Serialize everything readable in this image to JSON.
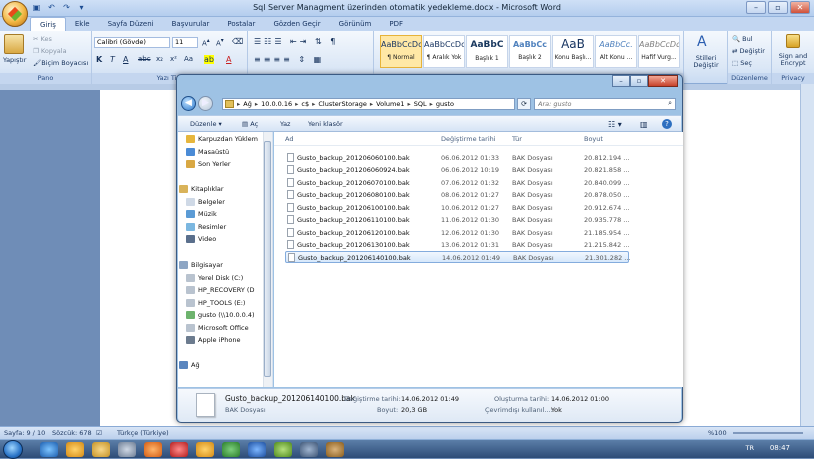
{
  "word": {
    "title": "Sql Server Managment üzerinden otomatik yedekleme.docx - Microsoft Word",
    "tabs": [
      "Giriş",
      "Ekle",
      "Sayfa Düzeni",
      "Başvurular",
      "Postalar",
      "Gözden Geçir",
      "Görünüm",
      "PDF"
    ],
    "clipboard": {
      "paste": "Yapıştır",
      "cut": "Kes",
      "copy": "Kopyala",
      "format_painter": "Biçim Boyacısı",
      "label": "Pano"
    },
    "font": {
      "name": "Calibri (Gövde)",
      "size": "11",
      "label": "Yazı Tipi"
    },
    "styles": [
      {
        "sample": "AaBbCcDc",
        "name": "¶ Normal"
      },
      {
        "sample": "AaBbCcDc",
        "name": "¶ Aralık Yok"
      },
      {
        "sample": "AaBbC",
        "name": "Başlık 1"
      },
      {
        "sample": "AaBbCc",
        "name": "Başlık 2"
      },
      {
        "sample": "AaB",
        "name": "Konu Başlı..."
      },
      {
        "sample": "AaBbCc.",
        "name": "Alt Konu ..."
      },
      {
        "sample": "AaBbCcDc",
        "name": "Hafif Vurg..."
      }
    ],
    "change_styles": "Stilleri Değiştir",
    "editing": {
      "find": "Bul",
      "replace": "Değiştir",
      "select": "Seç",
      "label": "Düzenleme"
    },
    "privacy": {
      "sign": "Sign and Encrypt",
      "label": "Privacy"
    },
    "status": {
      "page": "Sayfa: 9 / 10",
      "words": "Sözcük: 678",
      "language": "Türkçe (Türkiye)",
      "zoom": "%100"
    }
  },
  "taskbar": {
    "lang": "TR",
    "time": "08:47"
  },
  "explorer": {
    "breadcrumb": [
      "Ağ",
      "10.0.0.16",
      "c$",
      "ClusterStorage",
      "Volume1",
      "SQL",
      "gusto"
    ],
    "search_placeholder": "Ara: gusto",
    "commands": {
      "organize": "Düzenle",
      "open": "Aç",
      "print": "Yaz",
      "new_folder": "Yeni klasör"
    },
    "nav": {
      "favorites": [
        "Karpuzdan Yüklem",
        "Masaüstü",
        "Son Yerler"
      ],
      "libraries_title": "Kitaplıklar",
      "libraries": [
        "Belgeler",
        "Müzik",
        "Resimler",
        "Video"
      ],
      "computer_title": "Bilgisayar",
      "computer": [
        "Yerel Disk (C:)",
        "HP_RECOVERY (D",
        "HP_TOOLS (E:)",
        "gusto (\\\\10.0.0.4)",
        "Microsoft Office",
        "Apple iPhone"
      ],
      "network_title": "Ağ"
    },
    "columns": {
      "name": "Ad",
      "date": "Değiştirme tarihi",
      "type": "Tür",
      "size": "Boyut"
    },
    "files": [
      {
        "name": "Gusto_backup_201206060100.bak",
        "date": "06.06.2012 01:33",
        "type": "BAK Dosyası",
        "size": "20.812.194 ..."
      },
      {
        "name": "Gusto_backup_201206060924.bak",
        "date": "06.06.2012 10:19",
        "type": "BAK Dosyası",
        "size": "20.821.858 ..."
      },
      {
        "name": "Gusto_backup_201206070100.bak",
        "date": "07.06.2012 01:32",
        "type": "BAK Dosyası",
        "size": "20.840.099 ..."
      },
      {
        "name": "Gusto_backup_201206080100.bak",
        "date": "08.06.2012 01:27",
        "type": "BAK Dosyası",
        "size": "20.878.050 ..."
      },
      {
        "name": "Gusto_backup_201206100100.bak",
        "date": "10.06.2012 01:27",
        "type": "BAK Dosyası",
        "size": "20.912.674 ..."
      },
      {
        "name": "Gusto_backup_201206110100.bak",
        "date": "11.06.2012 01:30",
        "type": "BAK Dosyası",
        "size": "20.935.778 ..."
      },
      {
        "name": "Gusto_backup_201206120100.bak",
        "date": "12.06.2012 01:30",
        "type": "BAK Dosyası",
        "size": "21.185.954 ..."
      },
      {
        "name": "Gusto_backup_201206130100.bak",
        "date": "13.06.2012 01:31",
        "type": "BAK Dosyası",
        "size": "21.215.842 ..."
      },
      {
        "name": "Gusto_backup_201206140100.bak",
        "date": "14.06.2012 01:49",
        "type": "BAK Dosyası",
        "size": "21.301.282 ..."
      }
    ],
    "details": {
      "filename": "Gusto_backup_201206140100.bak",
      "filetype": "BAK Dosyası",
      "modified_label": "Değiştirme tarihi:",
      "modified": "14.06.2012 01:49",
      "size_label": "Boyut:",
      "size": "20,3 GB",
      "created_label": "Oluşturma tarihi:",
      "created": "14.06.2012 01:00",
      "offline_label": "Çevrimdışı kullanıl...:",
      "offline": "Yok"
    }
  }
}
